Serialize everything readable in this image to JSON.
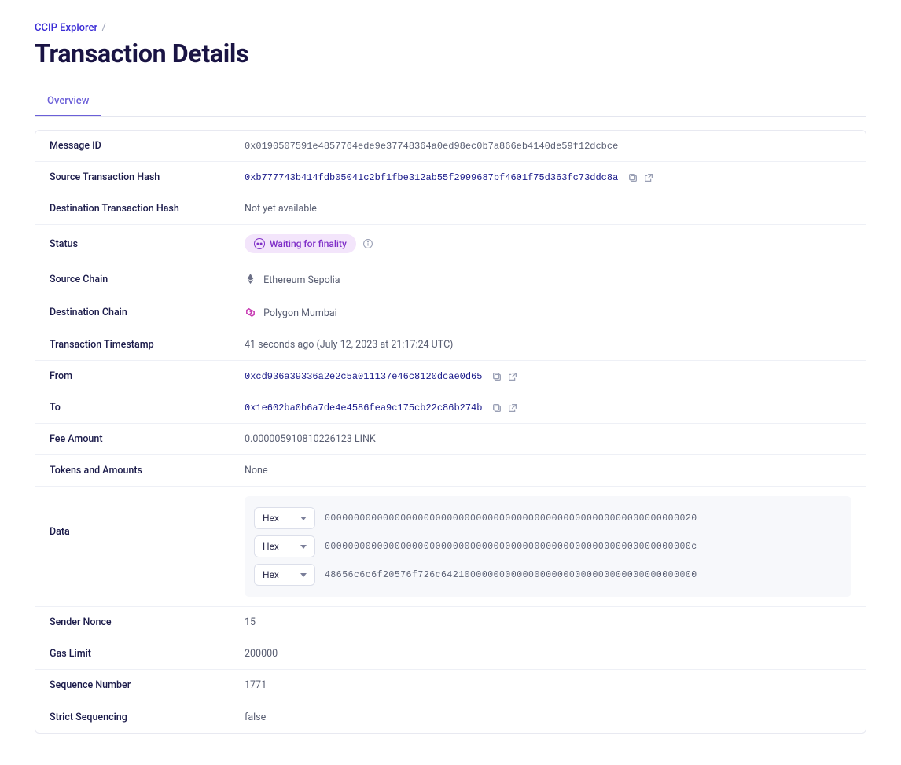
{
  "breadcrumb": {
    "root": "CCIP Explorer",
    "sep": "/"
  },
  "page_title": "Transaction Details",
  "tabs": {
    "overview": "Overview"
  },
  "labels": {
    "message_id": "Message ID",
    "source_tx_hash": "Source Transaction Hash",
    "dest_tx_hash": "Destination Transaction Hash",
    "status": "Status",
    "source_chain": "Source Chain",
    "dest_chain": "Destination Chain",
    "tx_timestamp": "Transaction Timestamp",
    "from": "From",
    "to": "To",
    "fee_amount": "Fee Amount",
    "tokens_amounts": "Tokens and Amounts",
    "data": "Data",
    "sender_nonce": "Sender Nonce",
    "gas_limit": "Gas Limit",
    "sequence_number": "Sequence Number",
    "strict_sequencing": "Strict Sequencing"
  },
  "values": {
    "message_id": "0x0190507591e4857764ede9e37748364a0ed98ec0b7a866eb4140de59f12dcbce",
    "source_tx_hash": "0xb777743b414fdb05041c2bf1fbe312ab55f2999687bf4601f75d363fc73ddc8a",
    "dest_tx_hash": "Not yet available",
    "status_text": "Waiting for finality",
    "source_chain": "Ethereum Sepolia",
    "dest_chain": "Polygon Mumbai",
    "tx_timestamp": "41 seconds ago (July 12, 2023 at 21:17:24 UTC)",
    "from": "0xcd936a39336a2e2c5a011137e46c8120dcae0d65",
    "to": "0x1e602ba0b6a7de4e4586fea9c175cb22c86b274b",
    "fee_amount": "0.000005910810226123 LINK",
    "tokens_amounts": "None",
    "sender_nonce": "15",
    "gas_limit": "200000",
    "sequence_number": "1771",
    "strict_sequencing": "false"
  },
  "data_rows": {
    "format_label": "Hex",
    "r1": "0000000000000000000000000000000000000000000000000000000000000020",
    "r2": "000000000000000000000000000000000000000000000000000000000000000c",
    "r3": "48656c6c6f20576f726c64210000000000000000000000000000000000000000"
  }
}
